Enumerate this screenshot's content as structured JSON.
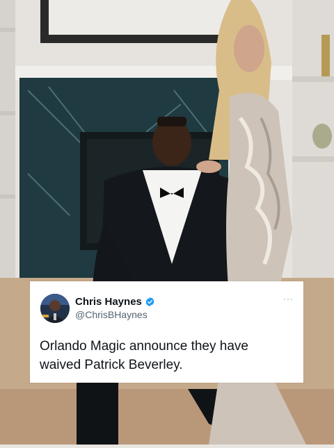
{
  "tweet": {
    "display_name": "Chris Haynes",
    "handle": "@ChrisBHaynes",
    "text": "Orlando Magic announce they have waived Patrick Beverley.",
    "more_glyph": "···",
    "verified_icon": "verified-badge-icon",
    "colors": {
      "verified": "#1d9bf0",
      "name": "#0f1419",
      "handle": "#536471"
    }
  }
}
